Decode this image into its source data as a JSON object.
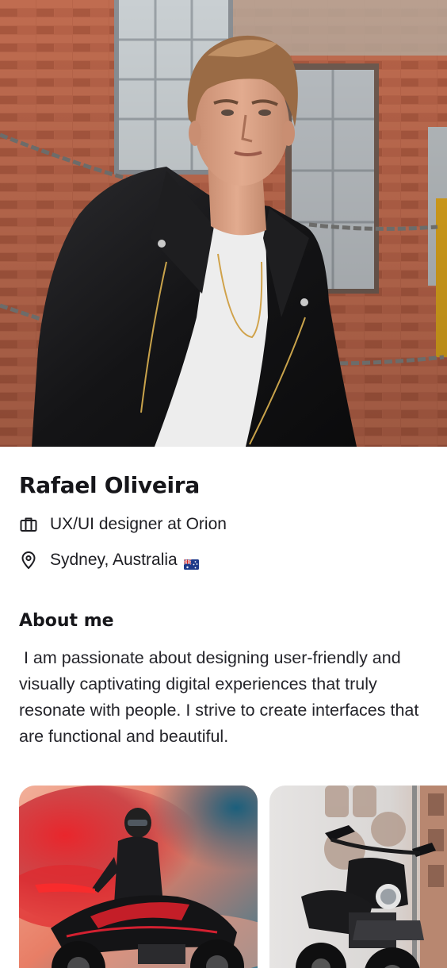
{
  "profile": {
    "name": "Rafael Oliveira",
    "job": "UX/UI designer at Orion",
    "location": "Sydney, Australia",
    "location_flag": "australia-flag-icon"
  },
  "about": {
    "title": "About me",
    "text": " I am passionate about designing user-friendly and visually captivating digital experiences that truly resonate with people. I strive to create interfaces that are functional and beautiful."
  },
  "gallery": {
    "items": [
      {
        "subject": "rider with red smoke on sport motorcycle"
      },
      {
        "subject": "black naked motorcycle in front of building"
      }
    ]
  },
  "icons": {
    "job": "briefcase-icon",
    "location": "location-pin-icon"
  },
  "colors": {
    "text": "#16161a",
    "brick": "#b25f45",
    "background": "#ffffff"
  }
}
